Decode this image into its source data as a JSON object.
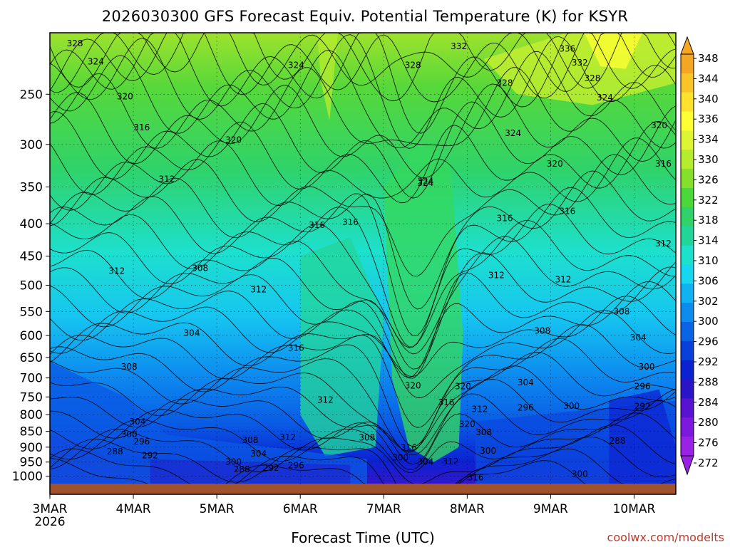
{
  "chart_data": {
    "type": "heatmap",
    "title": "2026030300 GFS Forecast Equiv. Potential Temperature (K) for KSYR",
    "xlabel": "Forecast Time (UTC)",
    "ylabel": "",
    "credit": "coolwx.com/modelts",
    "x_ticks": [
      {
        "value": 0,
        "label": "3MAR",
        "sub": "2026"
      },
      {
        "value": 1,
        "label": "4MAR",
        "sub": ""
      },
      {
        "value": 2,
        "label": "5MAR",
        "sub": ""
      },
      {
        "value": 3,
        "label": "6MAR",
        "sub": ""
      },
      {
        "value": 4,
        "label": "7MAR",
        "sub": ""
      },
      {
        "value": 5,
        "label": "8MAR",
        "sub": ""
      },
      {
        "value": 6,
        "label": "9MAR",
        "sub": ""
      },
      {
        "value": 7,
        "label": "10MAR",
        "sub": ""
      }
    ],
    "xlim": [
      0,
      7.5
    ],
    "y_ticks": [
      250,
      300,
      350,
      400,
      450,
      500,
      550,
      600,
      650,
      700,
      750,
      800,
      850,
      900,
      950,
      1000
    ],
    "ylim": [
      200,
      1030
    ],
    "y_scale": "log-pressure",
    "colorbar": {
      "labels": [
        348,
        344,
        340,
        336,
        334,
        330,
        326,
        322,
        318,
        314,
        310,
        306,
        302,
        300,
        296,
        292,
        288,
        284,
        280,
        276,
        272
      ],
      "colors": [
        "#f5a623",
        "#fbc52a",
        "#ffe12e",
        "#ffff33",
        "#ddf533",
        "#b5ec2e",
        "#84e02a",
        "#4cd83a",
        "#2fd36a",
        "#22d69a",
        "#1de0cd",
        "#16d6f0",
        "#10b2f2",
        "#0d8cf0",
        "#0a64e6",
        "#0840dc",
        "#0b22d2",
        "#2b13c8",
        "#5812d2",
        "#7d18de",
        "#9a22e6"
      ]
    },
    "contour_labels": [
      {
        "value": "328",
        "x": 0.3,
        "p": 208
      },
      {
        "value": "324",
        "x": 0.55,
        "p": 222
      },
      {
        "value": "320",
        "x": 0.9,
        "p": 252
      },
      {
        "value": "316",
        "x": 1.1,
        "p": 282
      },
      {
        "value": "312",
        "x": 1.4,
        "p": 340
      },
      {
        "value": "312",
        "x": 0.8,
        "p": 475
      },
      {
        "value": "308",
        "x": 1.8,
        "p": 470
      },
      {
        "value": "304",
        "x": 1.7,
        "p": 595
      },
      {
        "value": "308",
        "x": 0.95,
        "p": 672
      },
      {
        "value": "304",
        "x": 1.05,
        "p": 820
      },
      {
        "value": "300",
        "x": 0.95,
        "p": 860
      },
      {
        "value": "296",
        "x": 1.1,
        "p": 882
      },
      {
        "value": "288",
        "x": 0.78,
        "p": 914
      },
      {
        "value": "292",
        "x": 1.2,
        "p": 928
      },
      {
        "value": "324",
        "x": 2.95,
        "p": 225
      },
      {
        "value": "320",
        "x": 2.2,
        "p": 295
      },
      {
        "value": "316",
        "x": 3.2,
        "p": 402
      },
      {
        "value": "316",
        "x": 3.6,
        "p": 398
      },
      {
        "value": "312",
        "x": 2.5,
        "p": 508
      },
      {
        "value": "316",
        "x": 2.95,
        "p": 628
      },
      {
        "value": "312",
        "x": 3.3,
        "p": 758
      },
      {
        "value": "312",
        "x": 2.85,
        "p": 868
      },
      {
        "value": "308",
        "x": 2.4,
        "p": 878
      },
      {
        "value": "304",
        "x": 2.5,
        "p": 922
      },
      {
        "value": "300",
        "x": 2.2,
        "p": 950
      },
      {
        "value": "288",
        "x": 2.3,
        "p": 975
      },
      {
        "value": "292",
        "x": 2.65,
        "p": 970
      },
      {
        "value": "296",
        "x": 2.95,
        "p": 962
      },
      {
        "value": "308",
        "x": 3.8,
        "p": 870
      },
      {
        "value": "328",
        "x": 4.35,
        "p": 225
      },
      {
        "value": "332",
        "x": 4.9,
        "p": 210
      },
      {
        "value": "328",
        "x": 5.45,
        "p": 240
      },
      {
        "value": "324",
        "x": 4.5,
        "p": 345
      },
      {
        "value": "324",
        "x": 5.55,
        "p": 288
      },
      {
        "value": "320",
        "x": 6.05,
        "p": 322
      },
      {
        "value": "316",
        "x": 5.45,
        "p": 392
      },
      {
        "value": "316",
        "x": 6.2,
        "p": 382
      },
      {
        "value": "316",
        "x": 7.35,
        "p": 322
      },
      {
        "value": "320",
        "x": 7.3,
        "p": 280
      },
      {
        "value": "312",
        "x": 5.35,
        "p": 482
      },
      {
        "value": "312",
        "x": 6.15,
        "p": 490
      },
      {
        "value": "312",
        "x": 7.35,
        "p": 430
      },
      {
        "value": "308",
        "x": 6.85,
        "p": 550
      },
      {
        "value": "308",
        "x": 5.9,
        "p": 590
      },
      {
        "value": "304",
        "x": 7.05,
        "p": 605
      },
      {
        "value": "300",
        "x": 7.15,
        "p": 672
      },
      {
        "value": "296",
        "x": 7.1,
        "p": 722
      },
      {
        "value": "292",
        "x": 7.1,
        "p": 776
      },
      {
        "value": "288",
        "x": 6.8,
        "p": 880
      },
      {
        "value": "300",
        "x": 6.25,
        "p": 775
      },
      {
        "value": "296",
        "x": 5.7,
        "p": 780
      },
      {
        "value": "304",
        "x": 5.7,
        "p": 712
      },
      {
        "value": "320",
        "x": 4.35,
        "p": 720
      },
      {
        "value": "316",
        "x": 4.75,
        "p": 765
      },
      {
        "value": "320",
        "x": 4.95,
        "p": 722
      },
      {
        "value": "312",
        "x": 5.15,
        "p": 784
      },
      {
        "value": "320",
        "x": 5.0,
        "p": 828
      },
      {
        "value": "308",
        "x": 5.2,
        "p": 853
      },
      {
        "value": "316",
        "x": 4.3,
        "p": 902
      },
      {
        "value": "300",
        "x": 4.2,
        "p": 935
      },
      {
        "value": "304",
        "x": 4.5,
        "p": 950
      },
      {
        "value": "312",
        "x": 4.8,
        "p": 948
      },
      {
        "value": "300",
        "x": 5.25,
        "p": 912
      },
      {
        "value": "316",
        "x": 5.1,
        "p": 1005
      },
      {
        "value": "300",
        "x": 6.35,
        "p": 992
      },
      {
        "value": "336",
        "x": 6.2,
        "p": 212
      },
      {
        "value": "332",
        "x": 6.35,
        "p": 223
      },
      {
        "value": "328",
        "x": 6.5,
        "p": 236
      },
      {
        "value": "324",
        "x": 6.65,
        "p": 253
      },
      {
        "value": "324",
        "x": 4.5,
        "p": 343
      }
    ],
    "grid": true
  }
}
